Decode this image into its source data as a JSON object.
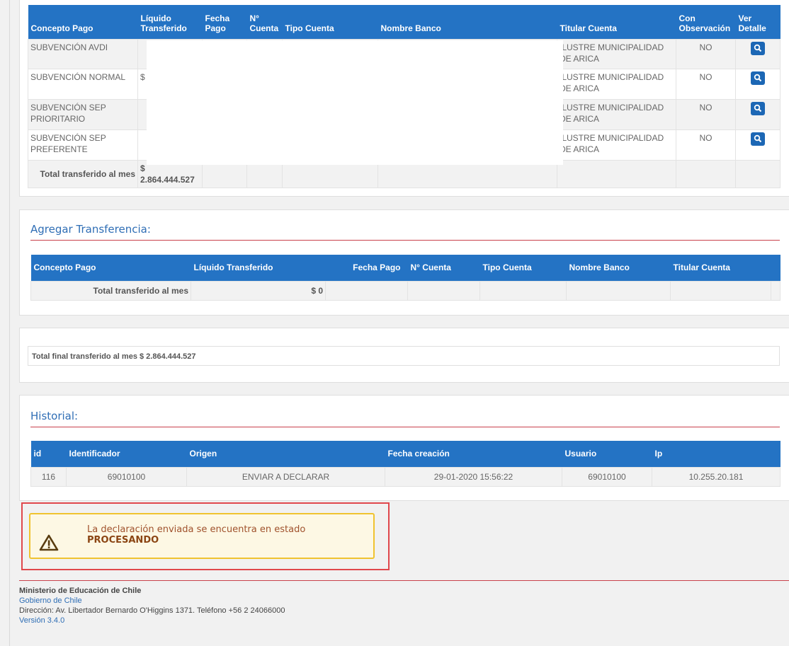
{
  "pagos": {
    "headers": [
      "Concepto Pago",
      "Líquido Transferido",
      "Fecha Pago",
      "N° Cuenta",
      "Tipo Cuenta",
      "Nombre Banco",
      "Titular Cuenta",
      "Con Observación",
      "Ver Detalle"
    ],
    "rows": [
      {
        "concepto": "SUBVENCIÓN AVDI",
        "liquido": "",
        "titular": "ILUSTRE MUNICIPALIDAD DE ARICA",
        "observacion": "NO"
      },
      {
        "concepto": "SUBVENCIÓN NORMAL",
        "liquido": "$",
        "titular": "ILUSTRE MUNICIPALIDAD DE ARICA",
        "observacion": "NO"
      },
      {
        "concepto": "SUBVENCIÓN SEP PRIORITARIO",
        "liquido": "",
        "titular": "ILUSTRE MUNICIPALIDAD DE ARICA",
        "observacion": "NO"
      },
      {
        "concepto": "SUBVENCIÓN SEP PREFERENTE",
        "liquido": "",
        "titular": "ILUSTRE MUNICIPALIDAD DE ARICA",
        "observacion": "NO"
      }
    ],
    "total_label": "Total transferido al mes",
    "total_value": "$ 2.864.444.527"
  },
  "agregar": {
    "title": "Agregar Transferencia:",
    "headers": [
      "Concepto Pago",
      "Líquido Transferido",
      "Fecha Pago",
      "N° Cuenta",
      "Tipo Cuenta",
      "Nombre Banco",
      "Titular Cuenta"
    ],
    "total_label": "Total transferido al mes",
    "total_value": "$ 0"
  },
  "total_final": "Total final transferido al mes $ 2.864.444.527",
  "historial": {
    "title": "Historial:",
    "headers": [
      "id",
      "Identificador",
      "Origen",
      "Fecha creación",
      "Usuario",
      "Ip"
    ],
    "row": {
      "id": "116",
      "identificador": "69010100",
      "origen": "ENVIAR A DECLARAR",
      "fecha": "29-01-2020 15:56:22",
      "usuario": "69010100",
      "ip": "10.255.20.181"
    }
  },
  "alert": {
    "text": "La declaración enviada se encuentra en estado ",
    "status": "PROCESANDO",
    "color": "#a0522d"
  },
  "footer": {
    "ministerio": "Ministerio de Educación de Chile",
    "gobierno": "Gobierno de Chile",
    "direccion": "Dirección: Av. Libertador Bernardo O'Higgins 1371. Teléfono +56 2 24066000",
    "version": "Versión 3.4.0"
  },
  "colors": {
    "header_blue": "#2473c4",
    "title_blue": "#2f6eb5",
    "rule_red": "#c9414c",
    "alert_border": "#f0c330",
    "alert_bg": "#fdf8e4"
  }
}
